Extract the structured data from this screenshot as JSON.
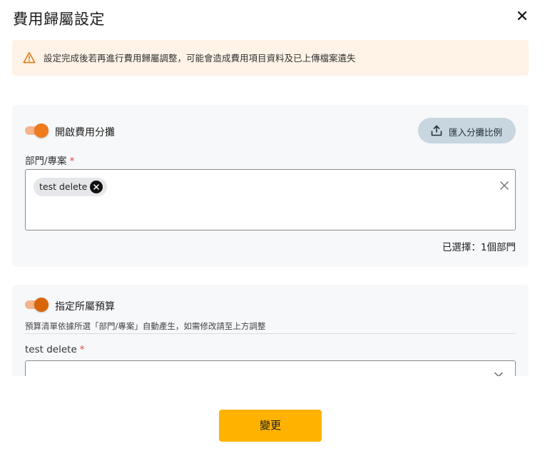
{
  "dialog": {
    "title": "費用歸屬設定",
    "close_icon": "close-icon"
  },
  "alert": {
    "icon": "warning-icon",
    "text": "設定完成後若再進行費用歸屬調整，可能會造成費用項目資料及已上傳檔案遺失"
  },
  "allocation": {
    "toggle_label": "開啟費用分攤",
    "toggle_on": true,
    "import_button": {
      "label": "匯入分攤比例",
      "icon": "upload-icon"
    },
    "department_field": {
      "label": "部門/專案",
      "required_mark": "*",
      "selected_chips": [
        "test delete"
      ],
      "clear_icon": "close-icon"
    },
    "selected_count_text": "已選擇：1個部門"
  },
  "budget": {
    "toggle_label": "指定所屬預算",
    "toggle_on": true,
    "hint": "預算清單依據所選「部門/專案」自動產生，如需修改請至上方調整",
    "select_field": {
      "label": "test delete",
      "required_mark": "*",
      "value": "",
      "dropdown_icon": "chevron-down-icon"
    }
  },
  "footer": {
    "submit_label": "變更"
  },
  "colors": {
    "accent": "#f07a1e",
    "alert_bg": "#fef3e6",
    "submit_bg": "#ffb300",
    "required": "#e0483a"
  }
}
